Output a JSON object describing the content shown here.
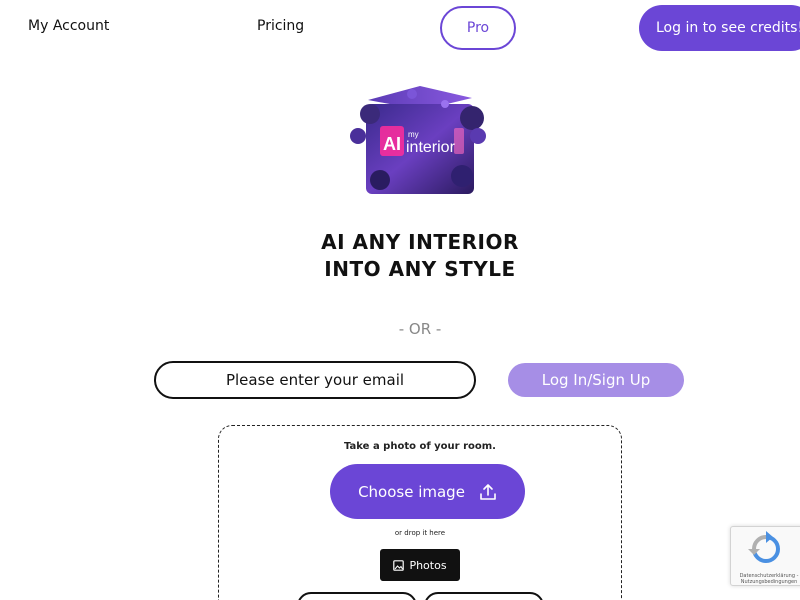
{
  "header": {
    "my_account": "My Account",
    "pricing": "Pricing",
    "pro": "Pro",
    "login_credits": "Log in to see credits!"
  },
  "logo": {
    "ai_text": "AI",
    "my_text": "my",
    "interior_text": "interior",
    "accent_color": "#ff2d9b"
  },
  "hero": {
    "line1": "AI ANY INTERIOR",
    "line2": "INTO ANY STYLE"
  },
  "divider": "- OR -",
  "login": {
    "email_placeholder": "Please enter your email",
    "button_label": "Log In/Sign Up"
  },
  "upload": {
    "hint": "Take a photo of your room.",
    "choose_label": "Choose image",
    "drop_hint": "or drop it here",
    "photos_label": "Photos"
  },
  "recaptcha": {
    "footer": "Datenschutzerklärung - Nutzungsbedingungen"
  },
  "colors": {
    "primary": "#6b46d6",
    "primary_light": "#a68ee6"
  }
}
